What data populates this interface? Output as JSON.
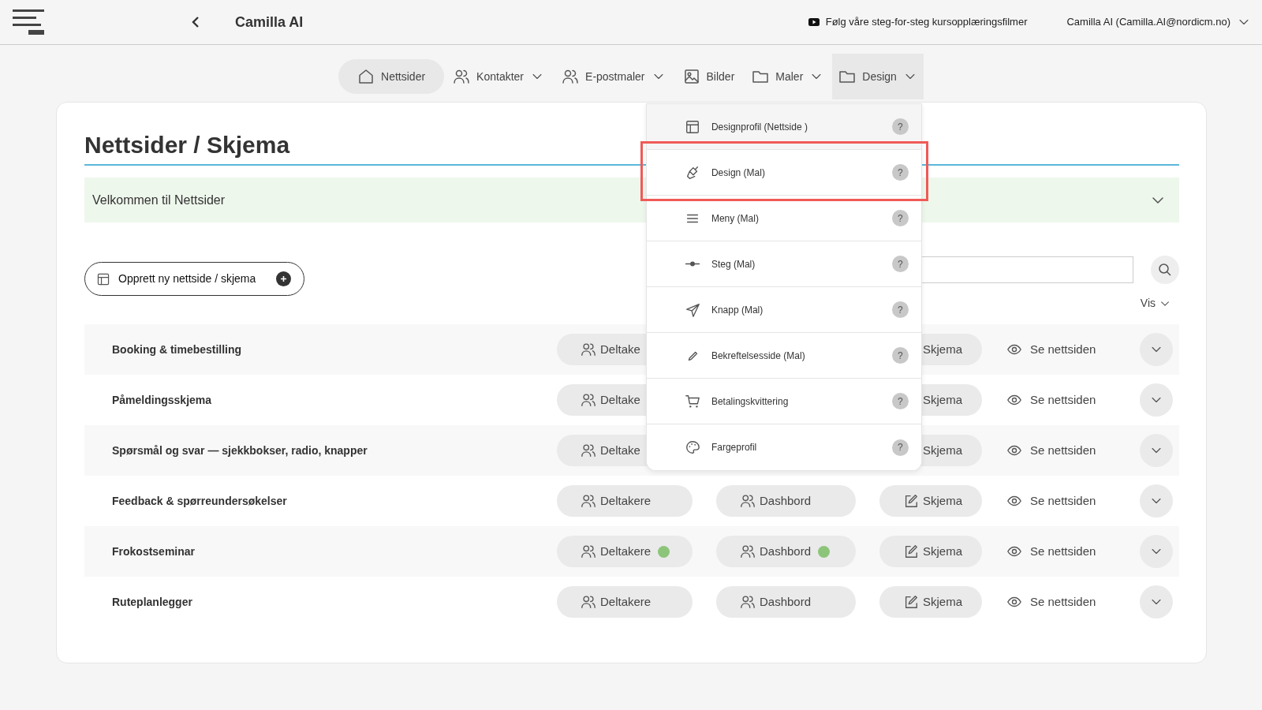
{
  "header": {
    "title": "Camilla AI",
    "tutorial_link": "Følg våre steg-for-steg kursopplæringsfilmer",
    "user": "Camilla AI (Camilla.AI@nordicm.no)"
  },
  "nav": [
    {
      "label": "Nettsider",
      "has_menu": false,
      "selected": true,
      "expanded": false
    },
    {
      "label": "Kontakter",
      "has_menu": true,
      "selected": false,
      "expanded": false
    },
    {
      "label": "E-postmaler",
      "has_menu": true,
      "selected": false,
      "expanded": false
    },
    {
      "label": "Bilder",
      "has_menu": false,
      "selected": false,
      "expanded": false
    },
    {
      "label": "Maler",
      "has_menu": true,
      "selected": false,
      "expanded": false
    },
    {
      "label": "Design",
      "has_menu": true,
      "selected": false,
      "expanded": true
    }
  ],
  "design_menu": [
    {
      "label": "Designprofil (Nettside )",
      "help": "?",
      "highlighted": false
    },
    {
      "label": "Design (Mal)",
      "help": "?",
      "highlighted": true
    },
    {
      "label": "Meny (Mal)",
      "help": "?",
      "highlighted": false
    },
    {
      "label": "Steg (Mal)",
      "help": "?",
      "highlighted": false
    },
    {
      "label": "Knapp (Mal)",
      "help": "?",
      "highlighted": false
    },
    {
      "label": "Bekreftelsesside (Mal)",
      "help": "?",
      "highlighted": false
    },
    {
      "label": "Betalingskvittering",
      "help": "?",
      "highlighted": false
    },
    {
      "label": "Fargeprofil",
      "help": "?",
      "highlighted": false
    }
  ],
  "page": {
    "title": "Nettsider / Skjema",
    "welcome": "Velkommen til Nettsider",
    "create_button": "Opprett ny nettside / skjema",
    "view_menu": "Vis"
  },
  "rows": [
    {
      "title": "Booking & timebestilling",
      "participants": {
        "label": "Deltake",
        "indicator": false
      },
      "form": {
        "label": "Skjema",
        "icon": false
      },
      "view": "Se nettsiden"
    },
    {
      "title": "Påmeldingsskjema",
      "participants": {
        "label": "Deltake",
        "indicator": false
      },
      "form": {
        "label": "Skjema",
        "icon": false
      },
      "view": "Se nettsiden"
    },
    {
      "title": "Spørsmål og svar — sjekkbokser, radio, knapper",
      "participants": {
        "label": "Deltake",
        "indicator": false
      },
      "form": {
        "label": "Skjema",
        "icon": false
      },
      "view": "Se nettsiden"
    },
    {
      "title": "Feedback & spørreundersøkelser",
      "participants": {
        "label": "Deltakere",
        "indicator": false
      },
      "dashboard": {
        "label": "Dashbord",
        "indicator": false
      },
      "form": {
        "label": "Skjema",
        "icon": true
      },
      "view": "Se nettsiden"
    },
    {
      "title": "Frokostseminar",
      "participants": {
        "label": "Deltakere",
        "indicator": true
      },
      "dashboard": {
        "label": "Dashbord",
        "indicator": true
      },
      "form": {
        "label": "Skjema",
        "icon": true
      },
      "view": "Se nettsiden"
    },
    {
      "title": "Ruteplanlegger",
      "participants": {
        "label": "Deltakere",
        "indicator": false
      },
      "dashboard": {
        "label": "Dashbord",
        "indicator": false
      },
      "form": {
        "label": "Skjema",
        "icon": true
      },
      "view": "Se nettsiden"
    }
  ]
}
